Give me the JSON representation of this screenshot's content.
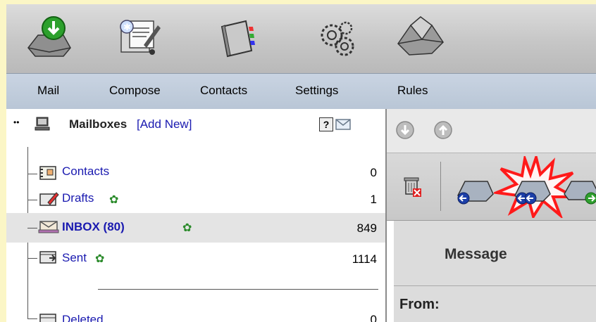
{
  "toolbar": {
    "items": [
      {
        "label": "Mail",
        "icon": "mail-get-icon"
      },
      {
        "label": "Compose",
        "icon": "compose-icon"
      },
      {
        "label": "Contacts",
        "icon": "address-book-icon"
      },
      {
        "label": "Settings",
        "icon": "settings-gears-icon"
      },
      {
        "label": "Rules",
        "icon": "rules-funnel-icon"
      }
    ]
  },
  "mailboxes": {
    "title": "Mailboxes",
    "add_new": "[Add New]",
    "help": "?",
    "folders": [
      {
        "name": "Contacts",
        "count": "0",
        "icon": "contacts-card-icon",
        "gear": false
      },
      {
        "name": "Drafts",
        "count": "1",
        "icon": "drafts-icon",
        "gear": true
      },
      {
        "name": "INBOX (80)",
        "count": "849",
        "icon": "inbox-icon",
        "gear": true,
        "selected": true
      },
      {
        "name": "Sent",
        "count": "1114",
        "icon": "sent-icon",
        "gear": true
      },
      {
        "name": "Deleted",
        "count": "0",
        "icon": "trash-folder-icon",
        "gear": false
      }
    ]
  },
  "message": {
    "title": "Message",
    "from_label": "From:"
  },
  "colors": {
    "page_bg": "#fbf6c6",
    "link": "#1a1ab0",
    "highlight_burst": "#ff1a1a"
  }
}
